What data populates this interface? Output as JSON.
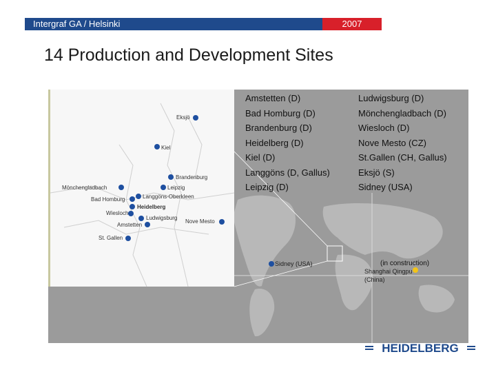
{
  "header": {
    "event": "Intergraf GA / Helsinki",
    "year": "2007"
  },
  "title": "14 Production and Development Sites",
  "sites_col1": [
    "Amstetten (D)",
    "Bad Homburg (D)",
    "Brandenburg (D)",
    "Heidelberg (D)",
    "Kiel (D)",
    "Langgöns (D, Gallus)",
    "Leipzig (D)"
  ],
  "sites_col2": [
    "Ludwigsburg (D)",
    "Mönchengladbach (D)",
    "Wiesloch (D)",
    "Nove Mesto (CZ)",
    "St.Gallen (CH, Gallus)",
    "Eksjö (S)",
    "Sidney (USA)"
  ],
  "map_labels": {
    "eksjo": "Eksjö",
    "kiel": "Kiel",
    "brandenburg": "Brandenburg",
    "moenchengladbach": "Mönchengladbach",
    "leipzig": "Leipzig",
    "bad_homburg": "Bad Homburg",
    "langgoens": "Langgöns-Oberkleen",
    "heidelberg": "Heidelberg",
    "wiesloch": "Wiesloch",
    "ludwigsburg": "Ludwigsburg",
    "nove_mesto": "Nove Mesto",
    "amstetten": "Amstetten",
    "st_gallen": "St. Gallen",
    "sidney": "Sidney (USA)",
    "shanghai": "Shanghai Qingpu",
    "shanghai_country": "(China)"
  },
  "construction_note": "(in construction)",
  "logo_text": "HEIDELBERG",
  "colors": {
    "header_blue": "#1f4a8c",
    "header_red": "#d8202a",
    "site_dot": "#1e4fa0",
    "shanghai_dot": "#f2c418"
  }
}
